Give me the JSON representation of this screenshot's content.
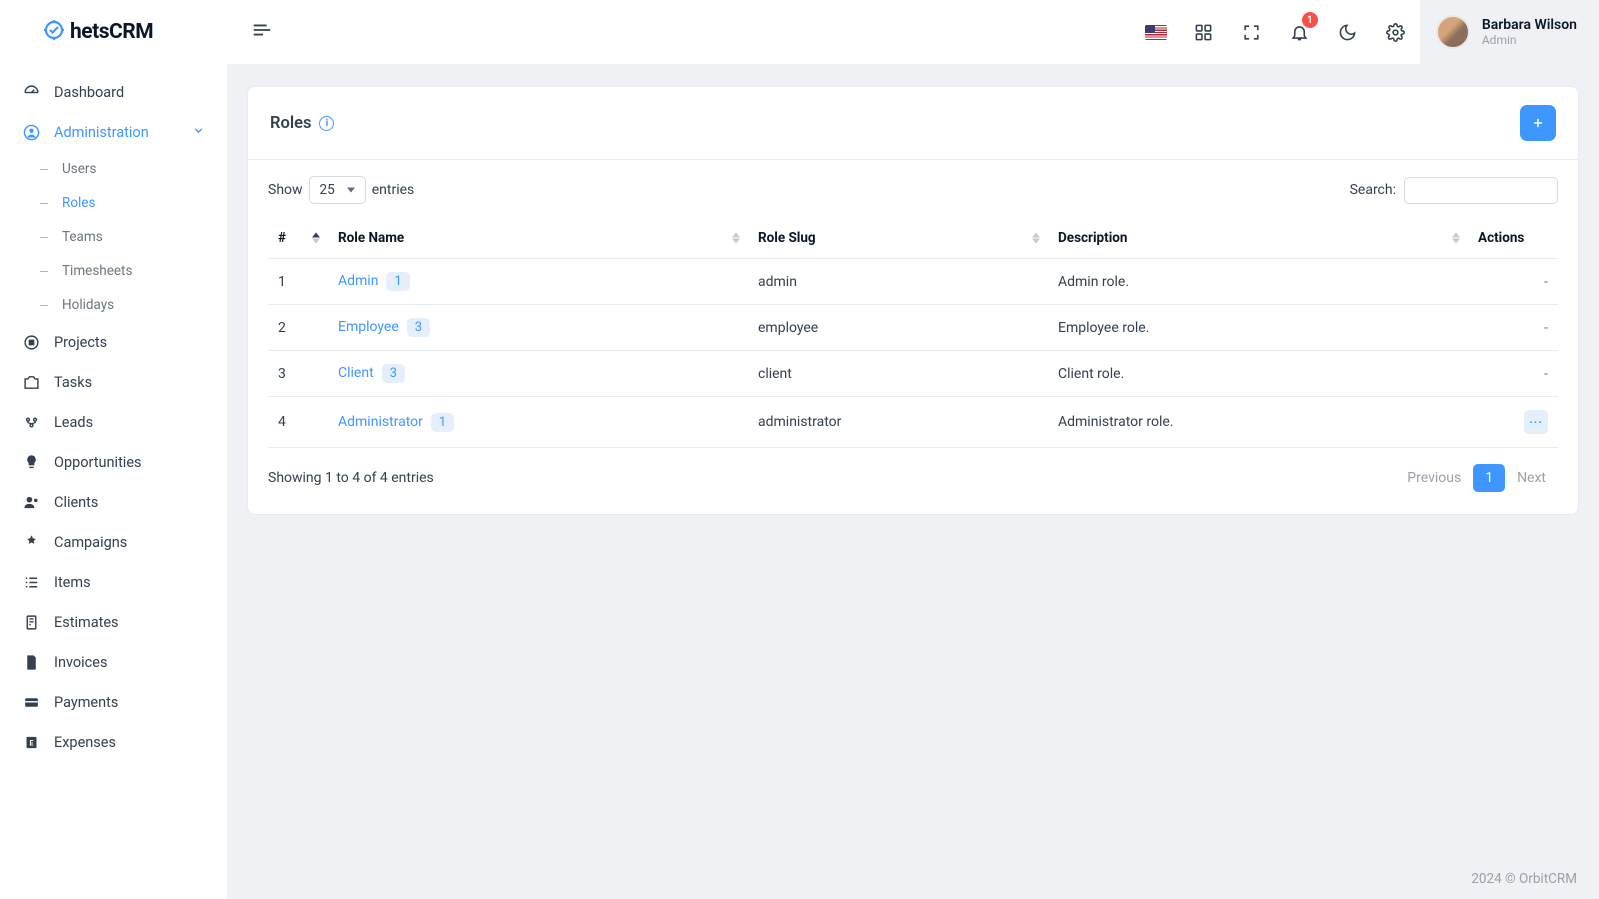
{
  "brand": {
    "text": "hetsCRM"
  },
  "user": {
    "name": "Barbara Wilson",
    "role": "Admin"
  },
  "notifications": {
    "count": "1"
  },
  "sidebar": {
    "items": [
      {
        "label": "Dashboard"
      },
      {
        "label": "Administration"
      },
      {
        "label": "Projects"
      },
      {
        "label": "Tasks"
      },
      {
        "label": "Leads"
      },
      {
        "label": "Opportunities"
      },
      {
        "label": "Clients"
      },
      {
        "label": "Campaigns"
      },
      {
        "label": "Items"
      },
      {
        "label": "Estimates"
      },
      {
        "label": "Invoices"
      },
      {
        "label": "Payments"
      },
      {
        "label": "Expenses"
      }
    ],
    "admin_sub": [
      {
        "label": "Users"
      },
      {
        "label": "Roles"
      },
      {
        "label": "Teams"
      },
      {
        "label": "Timesheets"
      },
      {
        "label": "Holidays"
      }
    ]
  },
  "page": {
    "title": "Roles"
  },
  "datatable": {
    "show_label": "Show",
    "entries_label": "entries",
    "length_value": "25",
    "search_label": "Search:",
    "columns": [
      "#",
      "Role Name",
      "Role Slug",
      "Description",
      "Actions"
    ],
    "rows": [
      {
        "num": "1",
        "name": "Admin",
        "count": "1",
        "slug": "admin",
        "desc": "Admin role.",
        "actions": "-"
      },
      {
        "num": "2",
        "name": "Employee",
        "count": "3",
        "slug": "employee",
        "desc": "Employee role.",
        "actions": "-"
      },
      {
        "num": "3",
        "name": "Client",
        "count": "3",
        "slug": "client",
        "desc": "Client role.",
        "actions": "-"
      },
      {
        "num": "4",
        "name": "Administrator",
        "count": "1",
        "slug": "administrator",
        "desc": "Administrator role.",
        "actions": "dots"
      }
    ],
    "info": "Showing 1 to 4 of 4 entries",
    "pager": {
      "prev": "Previous",
      "current": "1",
      "next": "Next"
    }
  },
  "footer": "2024 © OrbitCRM"
}
